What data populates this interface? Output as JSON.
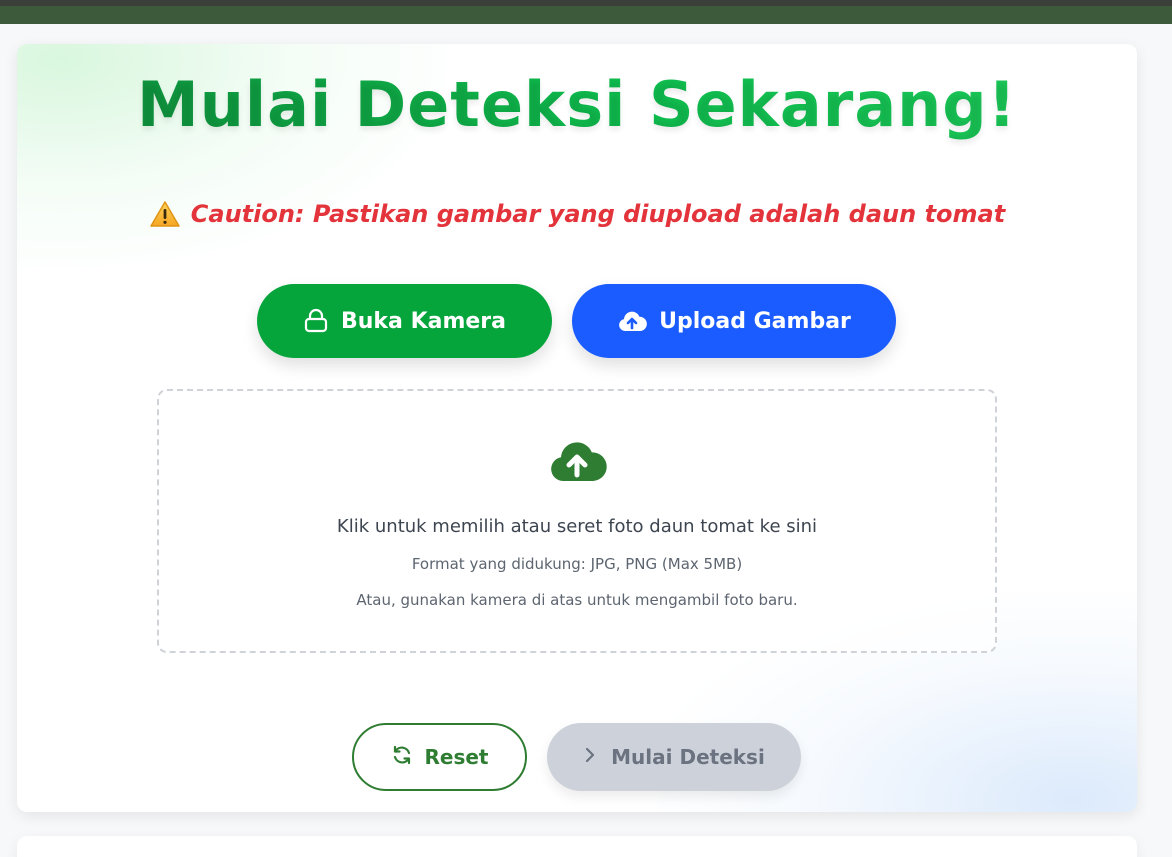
{
  "title": "Mulai Deteksi Sekarang!",
  "caution": {
    "icon": "warning-icon",
    "text": "Caution: Pastikan gambar yang diupload adalah daun tomat"
  },
  "buttons": {
    "camera": {
      "label": "Buka Kamera",
      "icon": "camera-icon"
    },
    "upload": {
      "label": "Upload Gambar",
      "icon": "cloud-upload-icon"
    }
  },
  "dropzone": {
    "icon": "cloud-upload-icon",
    "main_text": "Klik untuk memilih atau seret foto daun tomat ke sini",
    "formats_text": "Format yang didukung: JPG, PNG (Max 5MB)",
    "camera_hint": "Atau, gunakan kamera di atas untuk mengambil foto baru."
  },
  "actions": {
    "reset": {
      "label": "Reset",
      "icon": "refresh-icon"
    },
    "detect": {
      "label": "Mulai Deteksi",
      "icon": "chevron-right-icon",
      "disabled": true
    }
  },
  "colors": {
    "primary_green": "#06a53c",
    "primary_blue": "#1a5cff",
    "caution_red": "#e4343b",
    "dark_green": "#2e7d32",
    "disabled_gray": "#cdd2da",
    "topbar": "#3d5a3b"
  }
}
